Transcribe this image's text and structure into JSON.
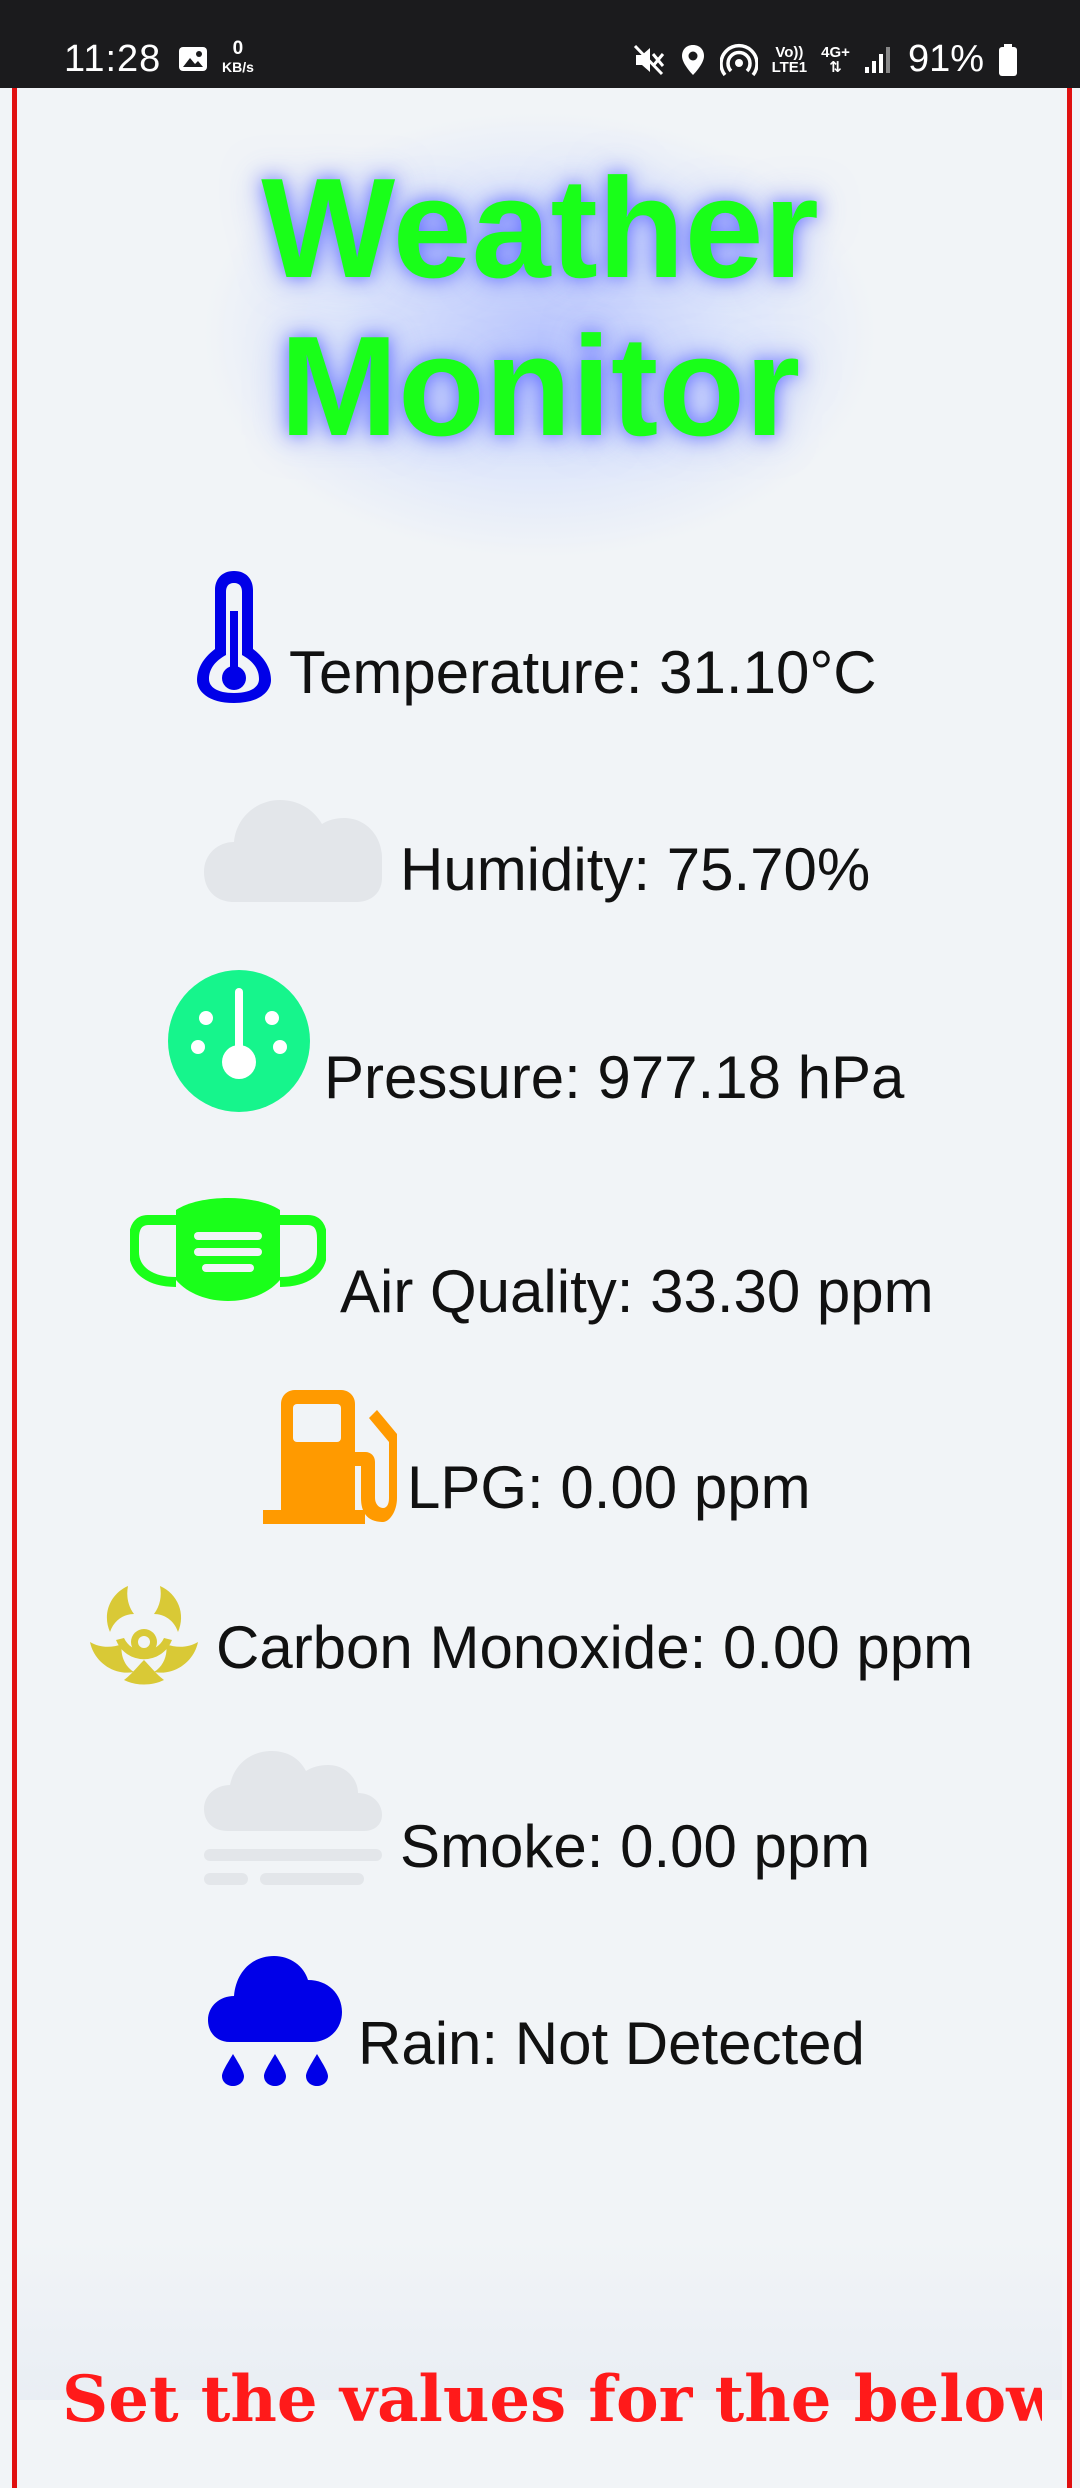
{
  "status_bar": {
    "time": "11:28",
    "net_speed_value": "0",
    "net_speed_unit": "KB/s",
    "volte_label": "Vo))",
    "lte_label": "LTE1",
    "network_type": "4G+",
    "battery": "91%"
  },
  "page": {
    "title_line1": "Weather",
    "title_line2": "Monitor"
  },
  "readings": [
    {
      "label": "Temperature: 31.10°C",
      "icon": "thermometer-icon",
      "color": "#0000e8"
    },
    {
      "label": "Humidity: 75.70%",
      "icon": "cloud-icon",
      "color": "#e3e6ea"
    },
    {
      "label": "Pressure: 977.18 hPa",
      "icon": "gauge-icon",
      "color": "#16f58c"
    },
    {
      "label": "Air Quality: 33.30 ppm",
      "icon": "mask-icon",
      "color": "#1aff1a"
    },
    {
      "label": "LPG: 0.00 ppm",
      "icon": "fuel-pump-icon",
      "color": "#ff9a00"
    },
    {
      "label": "Carbon Monoxide: 0.00 ppm",
      "icon": "biohazard-icon",
      "color": "#d9c936"
    },
    {
      "label": "Smoke: 0.00 ppm",
      "icon": "smog-icon",
      "color": "#e3e6ea"
    },
    {
      "label": "Rain: Not Detected",
      "icon": "rain-cloud-icon",
      "color": "#0000e8"
    }
  ],
  "footer": {
    "heading": "Set the values for the below"
  },
  "colors": {
    "frame_border": "#e01010",
    "title": "#19ff19",
    "footer_heading": "#ff1a1a"
  }
}
